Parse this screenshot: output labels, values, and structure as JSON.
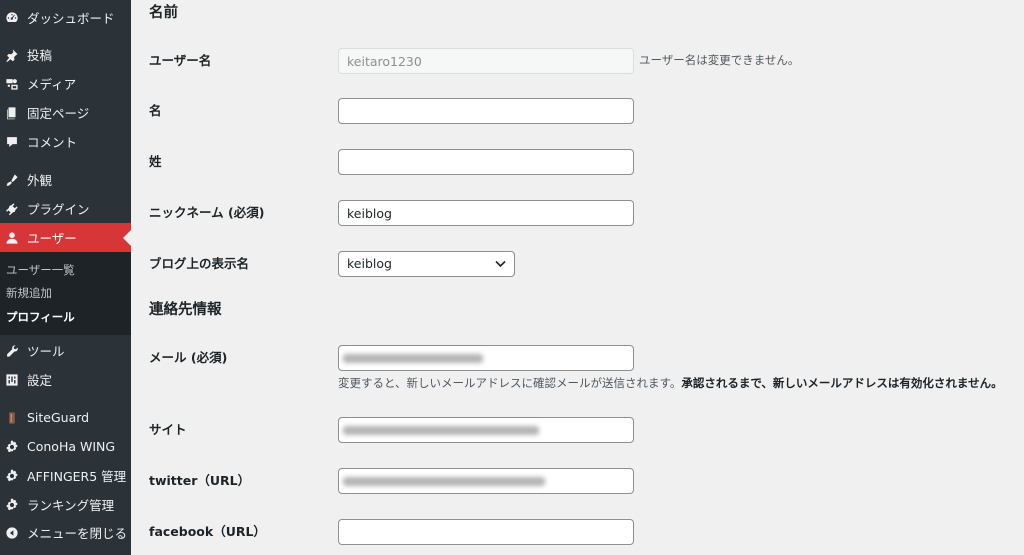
{
  "sidebar": {
    "items": [
      {
        "label": "ダッシュボード",
        "icon": "dashboard-icon"
      },
      {
        "label": "投稿",
        "icon": "pin-icon"
      },
      {
        "label": "メディア",
        "icon": "media-icon"
      },
      {
        "label": "固定ページ",
        "icon": "page-icon"
      },
      {
        "label": "コメント",
        "icon": "comment-icon"
      },
      {
        "label": "外観",
        "icon": "appearance-icon"
      },
      {
        "label": "プラグイン",
        "icon": "plugin-icon"
      },
      {
        "label": "ユーザー",
        "icon": "user-icon",
        "active": true
      },
      {
        "label": "ツール",
        "icon": "wrench-icon"
      },
      {
        "label": "設定",
        "icon": "settings-icon"
      },
      {
        "label": "SiteGuard",
        "icon": "siteguard-icon"
      },
      {
        "label": "ConoHa WING",
        "icon": "gear-icon"
      },
      {
        "label": "AFFINGER5 管理",
        "icon": "gear-icon"
      },
      {
        "label": "ランキング管理",
        "icon": "gear-icon"
      },
      {
        "label": "メニューを閉じる",
        "icon": "collapse-icon"
      }
    ],
    "submenu": [
      {
        "label": "ユーザー一覧"
      },
      {
        "label": "新規追加"
      },
      {
        "label": "プロフィール",
        "current": true
      }
    ],
    "active_color": "#d63638",
    "background": "#2c3338"
  },
  "form": {
    "name_heading": "名前",
    "username_label": "ユーザー名",
    "username_value": "keitaro1230",
    "username_note": "ユーザー名は変更できません。",
    "first_name_label": "名",
    "first_name_value": "",
    "last_name_label": "姓",
    "last_name_value": "",
    "nickname_label": "ニックネーム (必須)",
    "nickname_value": "keiblog",
    "display_name_label": "ブログ上の表示名",
    "display_name_selected": "keiblog",
    "contact_heading": "連絡先情報",
    "email_label": "メール (必須)",
    "email_help": "変更すると、新しいメールアドレスに確認メールが送信されます。",
    "email_help_bold": "承認されるまで、新しいメールアドレスは有効化されません。",
    "site_label": "サイト",
    "twitter_label": "twitter（URL）",
    "facebook_label": "facebook（URL）",
    "facebook_value": ""
  }
}
